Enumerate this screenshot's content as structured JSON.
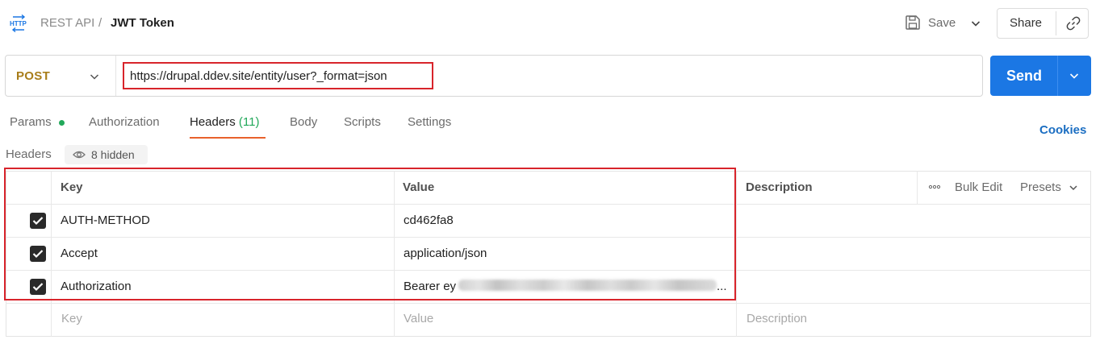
{
  "breadcrumb": {
    "icon": "http-icon",
    "parent": "REST API",
    "separator": "/",
    "title": "JWT Token"
  },
  "toolbar": {
    "save_label": "Save",
    "share_label": "Share"
  },
  "request": {
    "method": "POST",
    "url": "https://drupal.ddev.site/entity/user?_format=json",
    "send_label": "Send"
  },
  "tabs": {
    "params": "Params",
    "authorization": "Authorization",
    "headers": "Headers",
    "headers_count": "(11)",
    "body": "Body",
    "scripts": "Scripts",
    "settings": "Settings",
    "active": "Headers"
  },
  "cookies_label": "Cookies",
  "headers_section": {
    "label": "Headers",
    "hidden_label": "8 hidden"
  },
  "table": {
    "columns": {
      "key": "Key",
      "value": "Value",
      "description": "Description"
    },
    "bulk_edit": "Bulk Edit",
    "presets": "Presets",
    "rows": [
      {
        "checked": true,
        "key": "AUTH-METHOD",
        "value": "cd462fa8"
      },
      {
        "checked": true,
        "key": "Accept",
        "value": "application/json"
      },
      {
        "checked": true,
        "key": "Authorization",
        "value": "Bearer ey",
        "value_suffix": "..."
      }
    ],
    "placeholder": {
      "key": "Key",
      "value": "Value",
      "description": "Description"
    }
  },
  "colors": {
    "method": "#a87d1a",
    "send": "#1b77e4",
    "active_tab_underline": "#e8612c",
    "count_green": "#22a85a",
    "highlight_red": "#d8242b",
    "cookies": "#1b6ec2"
  }
}
